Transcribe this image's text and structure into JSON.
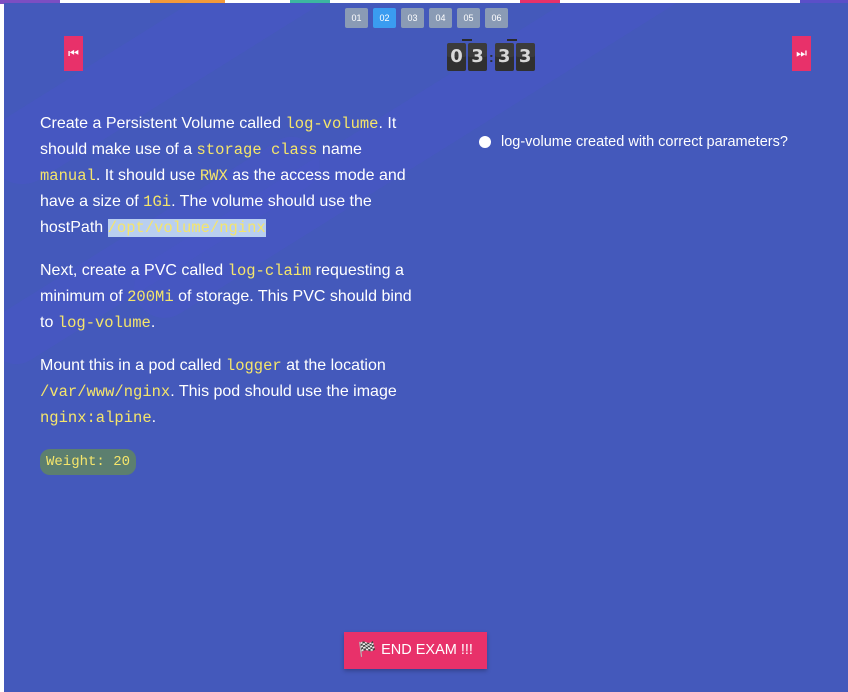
{
  "question_nav": [
    "01",
    "02",
    "03",
    "04",
    "05",
    "06"
  ],
  "active_question": "02",
  "nav": {
    "prev_icon": "⏮",
    "next_icon": "⏭"
  },
  "timer": {
    "d1": "0",
    "d2": "3",
    "d3": "3",
    "d4": "3"
  },
  "question": {
    "p1": {
      "t1": "Create a Persistent Volume called ",
      "c1": "log-volume",
      "t2": ". It should make use of a ",
      "c2": "storage class",
      "t3": " name ",
      "c3": "manual",
      "t4": ". It should use ",
      "c4": "RWX",
      "t5": " as the access mode and have a size of ",
      "c5": "1Gi",
      "t6": ". The volume should use the hostPath ",
      "c6": "/opt/volume/nginx"
    },
    "p2": {
      "t1": "Next, create a PVC called ",
      "c1": "log-claim",
      "t2": " requesting a minimum of ",
      "c2": "200Mi",
      "t3": " of storage. This PVC should bind to ",
      "c3": "log-volume",
      "t4": "."
    },
    "p3": {
      "t1": "Mount this in a pod called ",
      "c1": "logger",
      "t2": " at the location ",
      "c2": "/var/www/nginx",
      "t3": ". This pod should use the image ",
      "c3": "nginx:alpine",
      "t4": "."
    },
    "weight": "Weight: 20"
  },
  "checklist": [
    "log-volume created with correct parameters?"
  ],
  "end_button": {
    "icon": "🏁",
    "label": "END EXAM !!!"
  },
  "colors": {
    "background": "#4459bb",
    "accent": "#e8316a",
    "active_tab": "#3a9cf0",
    "inactive_tab": "#8a9bb5",
    "code": "#f5e56b"
  }
}
